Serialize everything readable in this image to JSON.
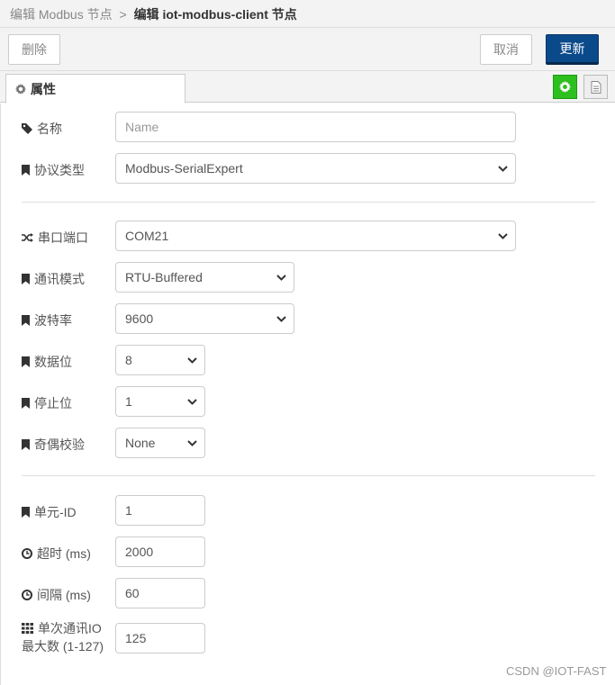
{
  "breadcrumb": {
    "parent": "编辑 Modbus 节点",
    "separator": ">",
    "current": "编辑 iot-modbus-client 节点"
  },
  "toolbar": {
    "delete_label": "删除",
    "cancel_label": "取消",
    "update_label": "更新"
  },
  "tabs": {
    "properties_label": "属性"
  },
  "fields": {
    "name": {
      "label": "名称",
      "placeholder": "Name",
      "value": ""
    },
    "protocol_type": {
      "label": "协议类型",
      "value": "Modbus-SerialExpert"
    },
    "serial_port": {
      "label": "串口端口",
      "value": "COM21"
    },
    "comm_mode": {
      "label": "通讯模式",
      "value": "RTU-Buffered"
    },
    "baud_rate": {
      "label": "波特率",
      "value": "9600"
    },
    "data_bits": {
      "label": "数据位",
      "value": "8"
    },
    "stop_bits": {
      "label": "停止位",
      "value": "1"
    },
    "parity": {
      "label": "奇偶校验",
      "value": "None"
    },
    "unit_id": {
      "label": "单元-ID",
      "value": "1"
    },
    "timeout": {
      "label": "超时 (ms)",
      "value": "2000"
    },
    "interval": {
      "label": "间隔 (ms)",
      "value": "60"
    },
    "max_io": {
      "label_line1": "单次通讯IO",
      "label_line2": "最大数 (1-127)",
      "value": "125"
    }
  },
  "watermark": "CSDN @IOT-FAST",
  "colors": {
    "update_button": "#0b4a8a",
    "settings_tab_button": "#2dbf1e"
  }
}
